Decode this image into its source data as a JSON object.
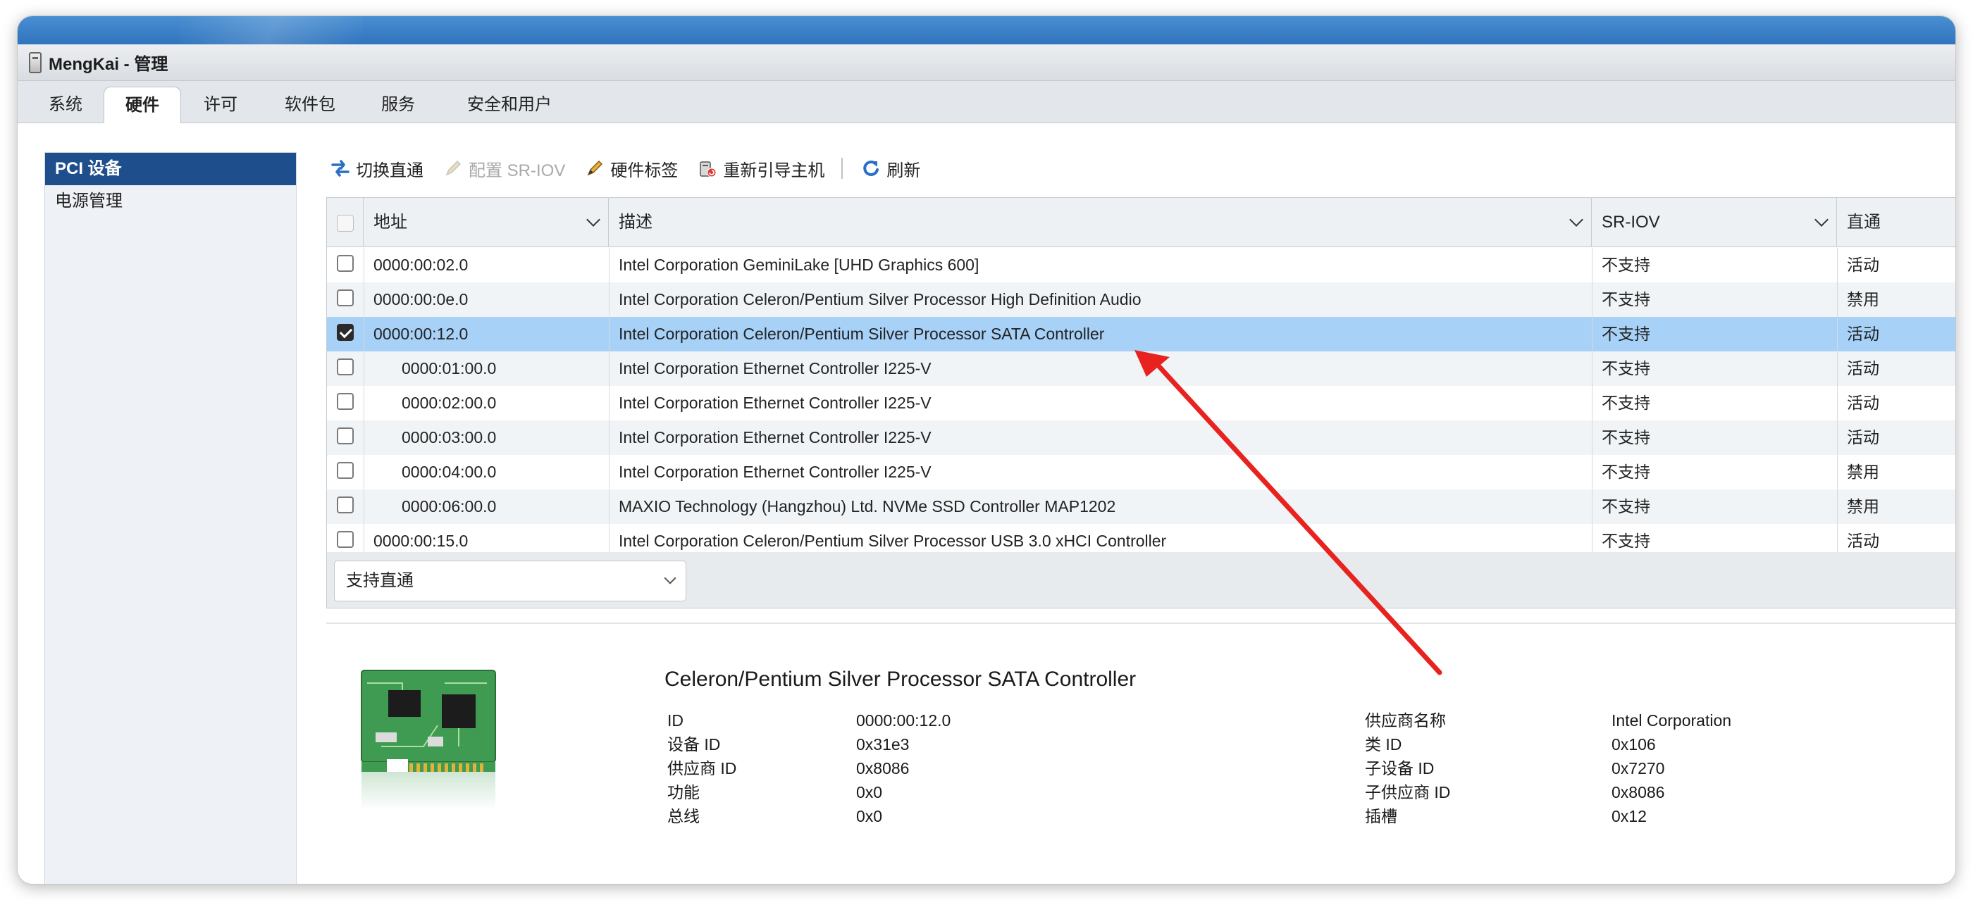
{
  "window": {
    "title": "MengKai - 管理"
  },
  "tabs": [
    {
      "label": "系统",
      "active": false
    },
    {
      "label": "硬件",
      "active": true
    },
    {
      "label": "许可",
      "active": false
    },
    {
      "label": "软件包",
      "active": false
    },
    {
      "label": "服务",
      "active": false
    },
    {
      "label": "安全和用户",
      "active": false
    }
  ],
  "sidebar": {
    "items": [
      {
        "label": "PCI 设备",
        "active": true
      },
      {
        "label": "电源管理",
        "active": false
      }
    ]
  },
  "toolbar": {
    "toggle_passthrough": "切换直通",
    "config_sriov": "配置 SR-IOV",
    "hardware_label": "硬件标签",
    "reboot_host": "重新引导主机",
    "refresh": "刷新",
    "icons": [
      "toggle-passthrough-icon",
      "pencil-icon",
      "pencil-icon",
      "reboot-host-icon",
      "refresh-icon"
    ]
  },
  "table": {
    "columns": [
      "地址",
      "描述",
      "SR-IOV",
      "直通"
    ],
    "rows": [
      {
        "checked": false,
        "indent": false,
        "address": "0000:00:02.0",
        "description": "Intel Corporation GeminiLake [UHD Graphics 600]",
        "sriov": "不支持",
        "passthrough": "活动"
      },
      {
        "checked": false,
        "indent": false,
        "address": "0000:00:0e.0",
        "description": "Intel Corporation Celeron/Pentium Silver Processor High Definition Audio",
        "sriov": "不支持",
        "passthrough": "禁用"
      },
      {
        "checked": true,
        "indent": false,
        "address": "0000:00:12.0",
        "description": "Intel Corporation Celeron/Pentium Silver Processor SATA Controller",
        "sriov": "不支持",
        "passthrough": "活动"
      },
      {
        "checked": false,
        "indent": true,
        "address": "0000:01:00.0",
        "description": "Intel Corporation Ethernet Controller I225-V",
        "sriov": "不支持",
        "passthrough": "活动"
      },
      {
        "checked": false,
        "indent": true,
        "address": "0000:02:00.0",
        "description": "Intel Corporation Ethernet Controller I225-V",
        "sriov": "不支持",
        "passthrough": "活动"
      },
      {
        "checked": false,
        "indent": true,
        "address": "0000:03:00.0",
        "description": "Intel Corporation Ethernet Controller I225-V",
        "sriov": "不支持",
        "passthrough": "活动"
      },
      {
        "checked": false,
        "indent": true,
        "address": "0000:04:00.0",
        "description": "Intel Corporation Ethernet Controller I225-V",
        "sriov": "不支持",
        "passthrough": "禁用"
      },
      {
        "checked": false,
        "indent": true,
        "address": "0000:06:00.0",
        "description": "MAXIO Technology (Hangzhou) Ltd. NVMe SSD Controller MAP1202",
        "sriov": "不支持",
        "passthrough": "禁用"
      },
      {
        "checked": false,
        "indent": false,
        "address": "0000:00:15.0",
        "description": "Intel Corporation Celeron/Pentium Silver Processor USB 3.0 xHCI Controller",
        "sriov": "不支持",
        "passthrough": "活动"
      }
    ]
  },
  "filter": {
    "selected": "支持直通"
  },
  "detail": {
    "title": "Celeron/Pentium Silver Processor SATA Controller",
    "left_fields": [
      {
        "label": "ID",
        "value": "0000:00:12.0"
      },
      {
        "label": "设备 ID",
        "value": "0x31e3"
      },
      {
        "label": "供应商 ID",
        "value": "0x8086"
      },
      {
        "label": "功能",
        "value": "0x0"
      },
      {
        "label": "总线",
        "value": "0x0"
      }
    ],
    "right_fields": [
      {
        "label": "供应商名称",
        "value": "Intel Corporation"
      },
      {
        "label": "类 ID",
        "value": "0x106"
      },
      {
        "label": "子设备 ID",
        "value": "0x7270"
      },
      {
        "label": "子供应商 ID",
        "value": "0x8086"
      },
      {
        "label": "插槽",
        "value": "0x12"
      }
    ]
  },
  "colors": {
    "selected_row": "#a7d1f7",
    "sidebar_active": "#1e4f8c",
    "annotation_arrow": "#e8231f"
  }
}
